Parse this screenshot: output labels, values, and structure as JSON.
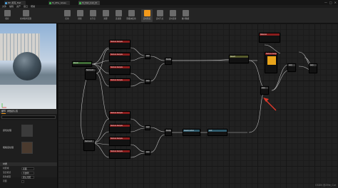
{
  "window": {
    "tabs": [
      {
        "label": "BP_坦克_Mat",
        "color": "#4aa3e0"
      },
      {
        "label": "M_ZHe_Glass",
        "color": "#3fb54a"
      },
      {
        "label": "M_Mat_Inst_M",
        "color": "#3fb54a"
      }
    ],
    "controls": [
      "—",
      "□",
      "✕"
    ]
  },
  "menu": {
    "items": [
      "文件",
      "编辑",
      "资产",
      "窗口",
      "帮助"
    ]
  },
  "toolbar": {
    "buttons": [
      {
        "label": "保存",
        "icon": "save-icon",
        "active": false
      },
      {
        "label": "在内容浏览器",
        "icon": "browse-icon",
        "active": false
      },
      {
        "label": "应用",
        "icon": "apply-icon",
        "active": false
      },
      {
        "label": "搜索",
        "icon": "search-icon",
        "active": false
      },
      {
        "label": "主节点",
        "icon": "home-icon",
        "active": false
      },
      {
        "label": "清理",
        "icon": "clean-icon",
        "active": false
      },
      {
        "label": "连接器",
        "icon": "connector-icon",
        "active": false
      },
      {
        "label": "隐藏未使用",
        "icon": "hide-icon",
        "active": false
      },
      {
        "label": "实时预览",
        "icon": "live-preview-icon",
        "active": true
      },
      {
        "label": "实时节点",
        "icon": "live-nodes-icon",
        "active": false
      },
      {
        "label": "实时更新",
        "icon": "live-update-icon",
        "active": false
      },
      {
        "label": "统计数据",
        "icon": "stats-icon",
        "active": false
      }
    ]
  },
  "details": {
    "tabs": [
      "细节",
      "参数默认值"
    ],
    "params": [
      {
        "label": "颜色纹理",
        "swatch": "#3b3b3b"
      },
      {
        "label": "粗糙度纹理",
        "swatch": "#4a3a2e"
      }
    ],
    "section_title": "材质",
    "fields": [
      {
        "key": "材质域",
        "value": "表面"
      },
      {
        "key": "混合模式",
        "value": "不透明"
      },
      {
        "key": "着色模型",
        "value": "默认光照"
      },
      {
        "key": "双面",
        "value": ""
      }
    ]
  },
  "graph": {
    "nodes": [
      {
        "title": "Param",
        "style": "green"
      },
      {
        "title": "TexCoord",
        "style": "gray"
      },
      {
        "title": "Texture Sample",
        "style": "red"
      },
      {
        "title": "Texture Sample",
        "style": "red"
      },
      {
        "title": "Texture Sample",
        "style": "red"
      },
      {
        "title": "Texture Sample",
        "style": "red"
      },
      {
        "title": "Lerp",
        "style": "gray"
      },
      {
        "title": "Lerp",
        "style": "gray"
      },
      {
        "title": "Multiply",
        "style": "gray"
      },
      {
        "title": "Texture Sample",
        "style": "red"
      },
      {
        "title": "Texture Sample",
        "style": "red"
      },
      {
        "title": "Texture Sample",
        "style": "red"
      },
      {
        "title": "Texture Sample",
        "style": "red"
      },
      {
        "title": "TexCoord",
        "style": "gray"
      },
      {
        "title": "Lerp",
        "style": "gray"
      },
      {
        "title": "Lerp",
        "style": "gray"
      },
      {
        "title": "Multiply",
        "style": "gray"
      },
      {
        "title": "Desaturation",
        "style": "teal"
      },
      {
        "title": "Add",
        "style": "gray"
      },
      {
        "title": "Result",
        "style": "olive"
      },
      {
        "title": "Material",
        "style": "red"
      },
      {
        "title": "Lerp",
        "style": "gray"
      },
      {
        "title": "Texture Sample",
        "style": "red"
      }
    ]
  },
  "annotation": {
    "arrow_color": "#e0392b"
  },
  "watermark": "CSDN @ZHe_Cui"
}
